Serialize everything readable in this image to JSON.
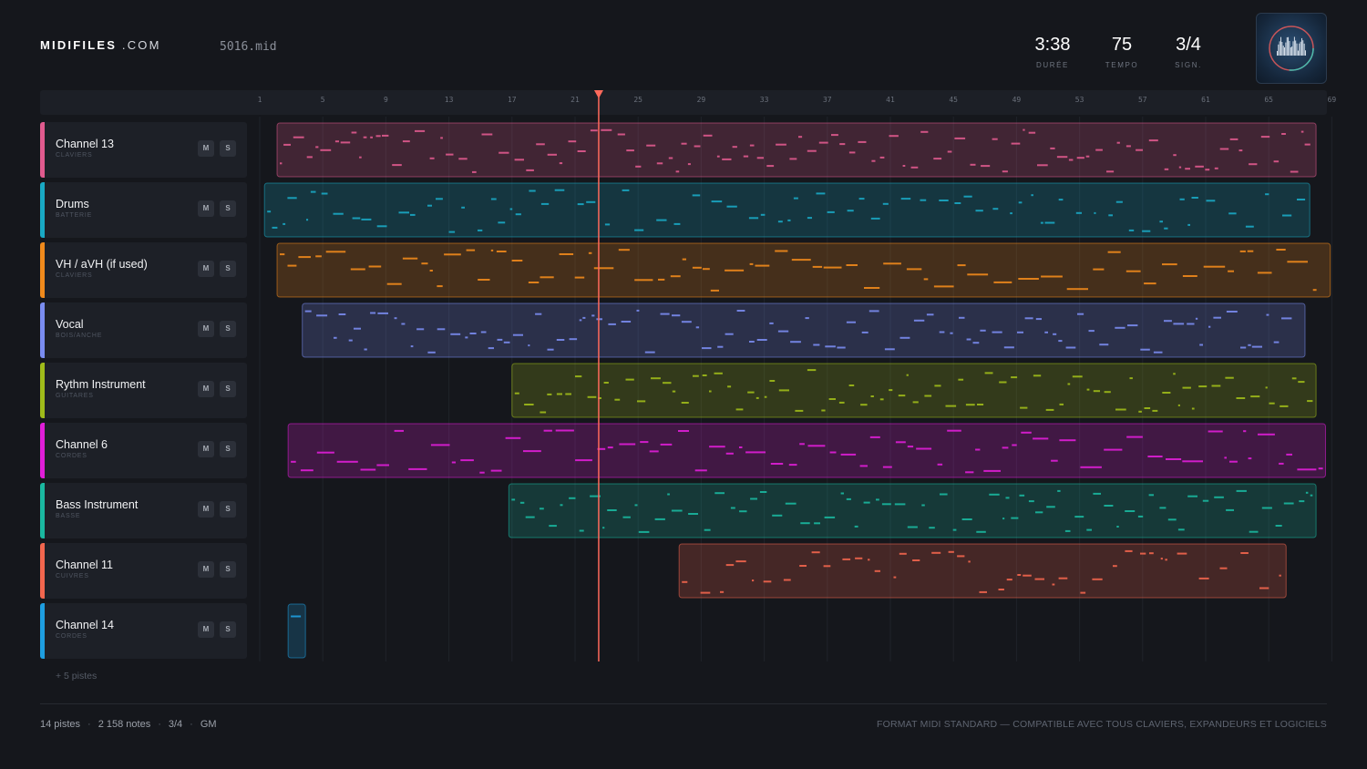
{
  "header": {
    "logo_bold": "MIDIFILES",
    "logo_light": ".COM",
    "filename": "5016.mid",
    "stats": [
      {
        "value": "3:38",
        "label": "DURÉE"
      },
      {
        "value": "75",
        "label": "TEMPO"
      },
      {
        "value": "3/4",
        "label": "SIGN."
      }
    ]
  },
  "ruler": {
    "ticks": [
      "1",
      "5",
      "9",
      "13",
      "17",
      "21",
      "25",
      "29",
      "33",
      "37",
      "41",
      "45",
      "49",
      "53",
      "57",
      "61",
      "65",
      "69"
    ]
  },
  "tracks": [
    {
      "name": "Channel 13",
      "category": "CLAVIERS",
      "color": "#e05a8e",
      "mute": "M",
      "solo": "S"
    },
    {
      "name": "Drums",
      "category": "BATTERIE",
      "color": "#19a9c4",
      "mute": "M",
      "solo": "S"
    },
    {
      "name": "VH / aVH (if used)",
      "category": "CLAVIERS",
      "color": "#f08a1c",
      "mute": "M",
      "solo": "S"
    },
    {
      "name": "Vocal",
      "category": "BOIS/ANCHE",
      "color": "#7a8cf0",
      "mute": "M",
      "solo": "S"
    },
    {
      "name": "Rythm Instrument",
      "category": "GUITARES",
      "color": "#9fbb1a",
      "mute": "M",
      "solo": "S"
    },
    {
      "name": "Channel 6",
      "category": "CORDES",
      "color": "#e01ed8",
      "mute": "M",
      "solo": "S"
    },
    {
      "name": "Bass Instrument",
      "category": "BASSE",
      "color": "#1ab8a0",
      "mute": "M",
      "solo": "S"
    },
    {
      "name": "Channel 11",
      "category": "CUIVRES",
      "color": "#f2664e",
      "mute": "M",
      "solo": "S"
    },
    {
      "name": "Channel 14",
      "category": "CORDES",
      "color": "#1e9ee0",
      "mute": "M",
      "solo": "S"
    }
  ],
  "more_tracks": "+ 5 pistes",
  "footer": {
    "tracks": "14 pistes",
    "notes": "2 158 notes",
    "signature": "3/4",
    "standard": "GM",
    "tagline": "FORMAT MIDI STANDARD — COMPATIBLE AVEC TOUS CLAVIERS, EXPANDEURS ET LOGICIELS"
  },
  "playhead_bar": 22.5,
  "total_bars": 69,
  "clips": [
    {
      "start": 2.1,
      "end": 68.0
    },
    {
      "start": 1.3,
      "end": 67.6
    },
    {
      "start": 2.1,
      "end": 68.9
    },
    {
      "start": 3.7,
      "end": 67.3
    },
    {
      "start": 17.0,
      "end": 68.0
    },
    {
      "start": 2.8,
      "end": 68.6
    },
    {
      "start": 16.8,
      "end": 68.0
    },
    {
      "start": 27.6,
      "end": 66.1
    },
    {
      "start": 2.8,
      "end": 3.9
    }
  ]
}
